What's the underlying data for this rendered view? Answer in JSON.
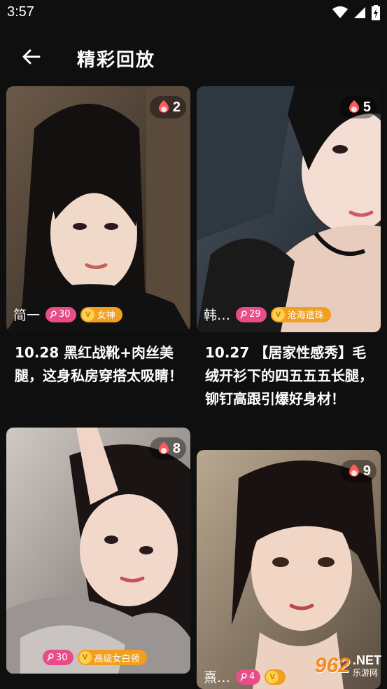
{
  "status_bar": {
    "time": "3:57"
  },
  "header": {
    "title": "精彩回放"
  },
  "cards": [
    {
      "heat": "2",
      "name": "简一",
      "level": "30",
      "tag": "女神",
      "title": "10.28 黑红战靴+肉丝美腿，这身私房穿搭太吸睛！"
    },
    {
      "heat": "5",
      "name": "韩…",
      "level": "29",
      "tag": "沧海遗珠",
      "title": "10.27 【居家性感秀】毛绒开衫下的四五五五长腿，铆钉高跟引爆好身材！"
    },
    {
      "heat": "8",
      "name": "",
      "level": "30",
      "tag": "高级女白领",
      "title": ""
    },
    {
      "heat": "9",
      "name": "熹…",
      "level": "4",
      "tag": "",
      "title": ""
    }
  ],
  "watermark": {
    "main": "962",
    "net": ".NET",
    "sub": "乐游网"
  },
  "colors": {
    "background": "#0f0f0f",
    "level_badge": "#e84d8a",
    "tag_badge": "#f0a01e",
    "heat_icon": "#ff5a5a"
  }
}
